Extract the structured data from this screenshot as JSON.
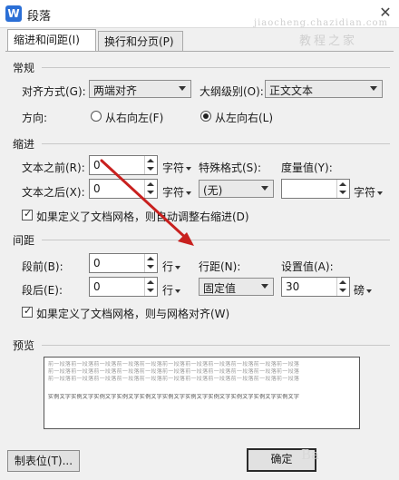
{
  "window": {
    "title": "段落",
    "close_glyph": "✕"
  },
  "tabs": [
    {
      "label": "缩进和间距(I)",
      "active": true
    },
    {
      "label": "换行和分页(P)",
      "active": false
    }
  ],
  "general": {
    "title": "常规",
    "alignment_label": "对齐方式(G):",
    "alignment_value": "两端对齐",
    "outline_label": "大纲级别(O):",
    "outline_value": "正文文本",
    "direction_label": "方向:",
    "rtl_label": "从右向左(F)",
    "ltr_label": "从左向右(L)"
  },
  "indent": {
    "title": "缩进",
    "before_label": "文本之前(R):",
    "before_value": "0",
    "before_unit": "字符",
    "after_label": "文本之后(X):",
    "after_value": "0",
    "after_unit": "字符",
    "special_label": "特殊格式(S):",
    "special_value": "(无)",
    "measure_label": "度量值(Y):",
    "measure_value": "",
    "measure_unit": "字符",
    "grid_checkbox_label": "如果定义了文档网格，则自动调整右缩进(D)"
  },
  "spacing": {
    "title": "间距",
    "before_label": "段前(B):",
    "before_value": "0",
    "before_unit": "行",
    "after_label": "段后(E):",
    "after_value": "0",
    "after_unit": "行",
    "line_label": "行距(N):",
    "line_value": "固定值",
    "set_label": "设置值(A):",
    "set_value": "30",
    "set_unit": "磅",
    "grid_checkbox_label": "如果定义了文档网格，则与网格对齐(W)"
  },
  "preview": {
    "title": "预览",
    "prev_text": "前一段落前一段落前一段落前一段落前一段落前一段落前一段落前一段落前一段落前一段落前一段落",
    "sample_text": "实例文字实例文字实例文字实例文字实例文字实例文字实例文字实例文字实例文字实例文字实例文字"
  },
  "buttons": {
    "tabs_label": "制表位(T)...",
    "ok_label": "确定"
  },
  "watermark": {
    "line1": "jiaocheng.chazidian.com",
    "line2": "教程之家",
    "corner": "Ba"
  },
  "colors": {
    "arrow": "#c8201e",
    "app_icon": "#2b6fd6"
  },
  "icons": {
    "app": "W"
  }
}
